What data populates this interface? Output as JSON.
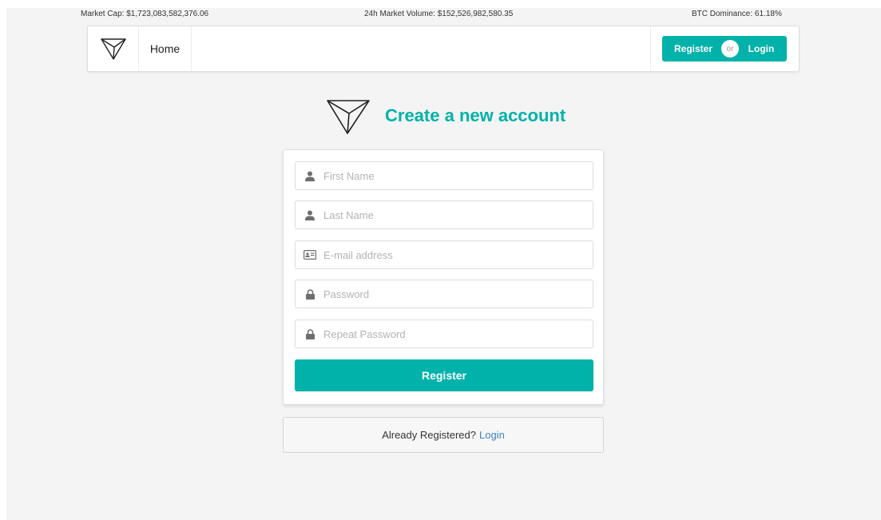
{
  "ticker": {
    "market_cap": "Market Cap: $1,723,083,582,376.06",
    "volume": "24h Market Volume: $152,526,982,580.35",
    "dominance": "BTC Dominance: 61.18%"
  },
  "nav": {
    "logo_icon": "triangle-logo-icon",
    "home": "Home",
    "register": "Register",
    "or": "or",
    "login": "Login"
  },
  "heading": {
    "title": "Create a new account"
  },
  "form": {
    "fields": [
      {
        "placeholder": "First Name",
        "value": "",
        "icon": "user-icon"
      },
      {
        "placeholder": "Last Name",
        "value": "",
        "icon": "user-icon"
      },
      {
        "placeholder": "E-mail address",
        "value": "",
        "icon": "id-card-icon"
      },
      {
        "placeholder": "Password",
        "value": "",
        "icon": "lock-icon"
      },
      {
        "placeholder": "Repeat Password",
        "value": "",
        "icon": "lock-icon"
      }
    ],
    "submit": "Register"
  },
  "footer_msg": {
    "text": "Already Registered?",
    "link": "Login"
  },
  "colors": {
    "accent": "#00b2a9",
    "link": "#4183c4",
    "background": "#f4f4f4"
  }
}
